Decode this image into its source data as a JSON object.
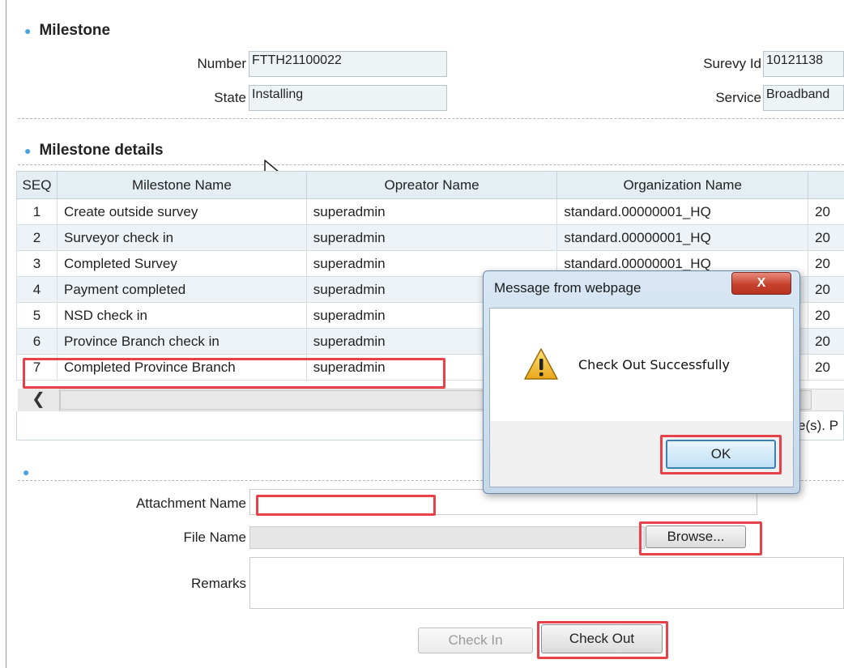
{
  "milestone": {
    "title": "Milestone",
    "number_label": "Number",
    "number_value": "FTTH21100022",
    "state_label": "State",
    "state_value": "Installing",
    "survey_label": "Surevy Id",
    "survey_value": "10121138",
    "service_label": "Service",
    "service_value": "Broadband"
  },
  "details": {
    "title": "Milestone details",
    "columns": [
      "SEQ",
      "Milestone Name",
      "Opreator Name",
      "Organization Name"
    ],
    "rows": [
      {
        "seq": "1",
        "name": "Create outside survey",
        "operator": "superadmin",
        "org": "standard.00000001_HQ",
        "time": "20"
      },
      {
        "seq": "2",
        "name": "Surveyor check in",
        "operator": "superadmin",
        "org": "standard.00000001_HQ",
        "time": "20"
      },
      {
        "seq": "3",
        "name": "Completed Survey",
        "operator": "superadmin",
        "org": "standard.00000001_HQ",
        "time": "20"
      },
      {
        "seq": "4",
        "name": "Payment completed",
        "operator": "superadmin",
        "org": "",
        "time": "20"
      },
      {
        "seq": "5",
        "name": "NSD check in",
        "operator": "superadmin",
        "org": "",
        "time": "20"
      },
      {
        "seq": "6",
        "name": "Province Branch check in",
        "operator": "superadmin",
        "org": "",
        "time": "20"
      },
      {
        "seq": "7",
        "name": "Completed Province Branch",
        "operator": "superadmin",
        "org": "",
        "time": "20"
      }
    ],
    "footer_fragment": "e(s). P",
    "scroll_left_icon": "chevron-left-icon"
  },
  "attachment": {
    "name_label": "Attachment Name",
    "file_label": "File Name",
    "browse_label": "Browse...",
    "remarks_label": "Remarks",
    "checkin_label": "Check In",
    "checkout_label": "Check Out"
  },
  "dialog": {
    "title": "Message from webpage",
    "close_glyph": "X",
    "message": "Check Out Successfully",
    "ok_label": "OK",
    "icon": "warning-icon"
  },
  "colors": {
    "highlight": "#e8414a",
    "bullet": "#4aa3df",
    "field_bg": "#eef3f6"
  }
}
